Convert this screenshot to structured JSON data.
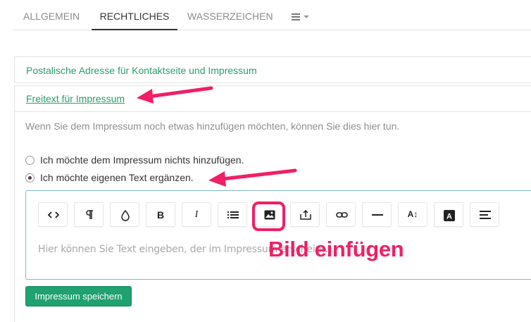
{
  "tabs": [
    {
      "label": "ALLGEMEIN"
    },
    {
      "label": "RECHTLICHES"
    },
    {
      "label": "WASSERZEICHEN"
    }
  ],
  "tab_menu_icon": "list-menu-icon",
  "sections": {
    "postal": "Postalische Adresse für Kontaktseite und Impressum",
    "freetext": "Freitext für Impressum"
  },
  "description": "Wenn Sie dem Impressum noch etwas hinzufügen möchten, können Sie dies hier tun.",
  "radios": [
    {
      "label": "Ich möchte dem Impressum nichts hinzufügen.",
      "checked": false
    },
    {
      "label": "Ich möchte eigenen Text ergänzen.",
      "checked": true
    }
  ],
  "toolbar": {
    "icons": [
      "code-view-icon",
      "paragraph-icon",
      "color-drop-icon",
      "bold-icon",
      "italic-icon",
      "list-icon",
      "image-icon",
      "upload-icon",
      "link-icon",
      "horizontal-rule-icon",
      "font-size-icon",
      "text-color-icon",
      "align-icon"
    ],
    "bold_label": "B",
    "italic_label": "I",
    "fontsize_label": "A↕",
    "textcolor_label": "A"
  },
  "editor": {
    "placeholder": "Hier können Sie Text eingeben, der im Impressum erscheint..."
  },
  "annotation": {
    "callout": "Bild einfügen",
    "color": "#f01f66"
  },
  "save_button": "Impressum speichern",
  "colors": {
    "accent_green": "#2a9d6f",
    "button_green": "#1fa170",
    "editor_border": "#7fb9d4"
  }
}
